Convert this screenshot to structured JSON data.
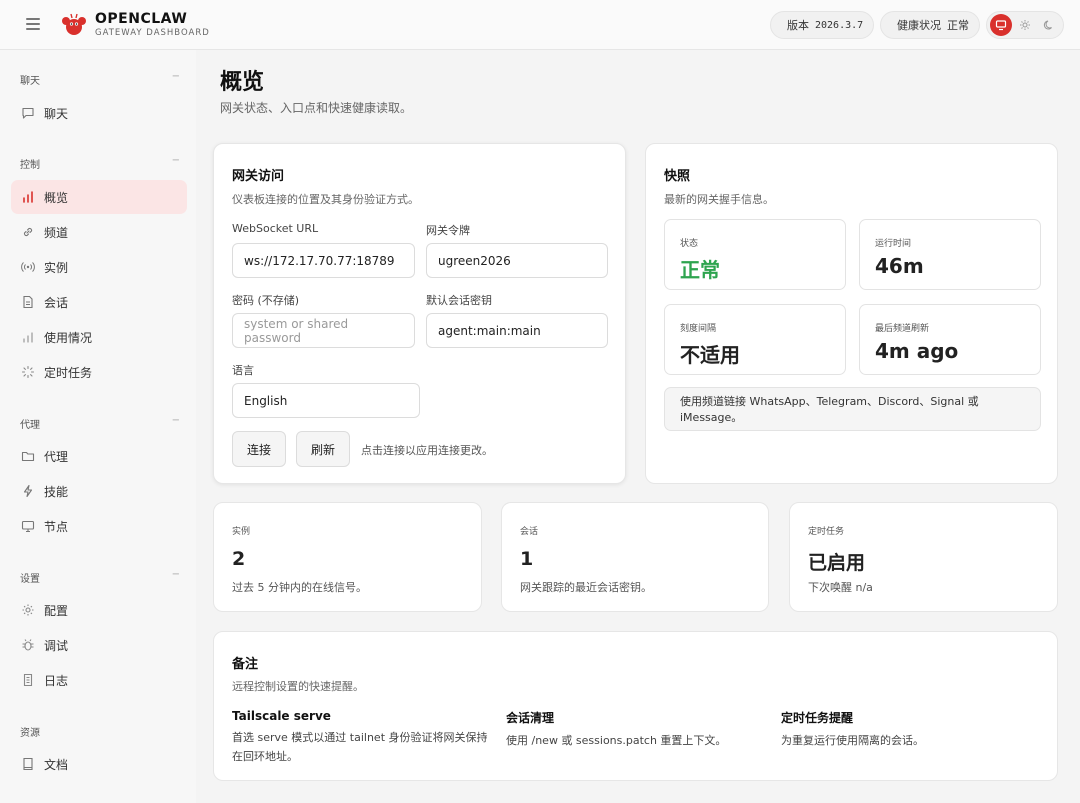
{
  "header": {
    "brand_title": "OPENCLAW",
    "brand_subtitle": "GATEWAY DASHBOARD",
    "version_label": "版本",
    "version_value": "2026.3.7",
    "health_label": "健康状况",
    "health_value": "正常"
  },
  "sidebar": {
    "groups": [
      {
        "title": "聊天",
        "items": [
          {
            "label": "聊天",
            "icon": "chat-icon"
          }
        ]
      },
      {
        "title": "控制",
        "items": [
          {
            "label": "概览",
            "icon": "bar-chart-icon",
            "active": true
          },
          {
            "label": "频道",
            "icon": "link-icon"
          },
          {
            "label": "实例",
            "icon": "broadcast-icon"
          },
          {
            "label": "会话",
            "icon": "document-icon"
          },
          {
            "label": "使用情况",
            "icon": "usage-bars-icon"
          },
          {
            "label": "定时任务",
            "icon": "spinner-icon"
          }
        ]
      },
      {
        "title": "代理",
        "items": [
          {
            "label": "代理",
            "icon": "folder-icon"
          },
          {
            "label": "技能",
            "icon": "lightning-icon"
          },
          {
            "label": "节点",
            "icon": "monitor-icon"
          }
        ]
      },
      {
        "title": "设置",
        "items": [
          {
            "label": "配置",
            "icon": "gear-icon"
          },
          {
            "label": "调试",
            "icon": "bug-icon"
          },
          {
            "label": "日志",
            "icon": "log-icon"
          }
        ]
      },
      {
        "title": "资源",
        "items": [
          {
            "label": "文档",
            "icon": "book-icon"
          }
        ]
      }
    ]
  },
  "page": {
    "title": "概览",
    "subtitle": "网关状态、入口点和快速健康读取。"
  },
  "gateway_access": {
    "title": "网关访问",
    "description": "仪表板连接的位置及其身份验证方式。",
    "websocket_label": "WebSocket URL",
    "websocket_value": "ws://172.17.70.77:18789",
    "token_label": "网关令牌",
    "token_value": "ugreen2026",
    "password_label": "密码 (不存储)",
    "password_placeholder": "system or shared password",
    "session_key_label": "默认会话密钥",
    "session_key_value": "agent:main:main",
    "language_label": "语言",
    "language_value": "English",
    "connect_label": "连接",
    "refresh_label": "刷新",
    "hint": "点击连接以应用连接更改。"
  },
  "snapshot": {
    "title": "快照",
    "description": "最新的网关握手信息。",
    "status_label": "状态",
    "status_value": "正常",
    "uptime_label": "运行时间",
    "uptime_value": "46m",
    "tick_label": "刻度间隔",
    "tick_value": "不适用",
    "last_refresh_label": "最后频道刷新",
    "last_refresh_value": "4m ago",
    "info": "使用频道链接 WhatsApp、Telegram、Discord、Signal 或 iMessage。"
  },
  "summary": [
    {
      "label": "实例",
      "value": "2",
      "desc": "过去 5 分钟内的在线信号。"
    },
    {
      "label": "会话",
      "value": "1",
      "desc": "网关跟踪的最近会话密钥。"
    },
    {
      "label": "定时任务",
      "value": "已启用",
      "desc": "下次唤醒 n/a"
    }
  ],
  "notes": {
    "title": "备注",
    "description": "远程控制设置的快速提醒。",
    "items": [
      {
        "head": "Tailscale serve",
        "body": "首选 serve 模式以通过 tailnet 身份验证将网关保持在回环地址。"
      },
      {
        "head": "会话清理",
        "body": "使用 /new 或 sessions.patch 重置上下文。"
      },
      {
        "head": "定时任务提醒",
        "body": "为重复运行使用隔离的会话。"
      }
    ]
  },
  "colors": {
    "accent": "#d9302c",
    "ok": "#2ea44f",
    "active_nav_bg": "#fbe5e5"
  }
}
